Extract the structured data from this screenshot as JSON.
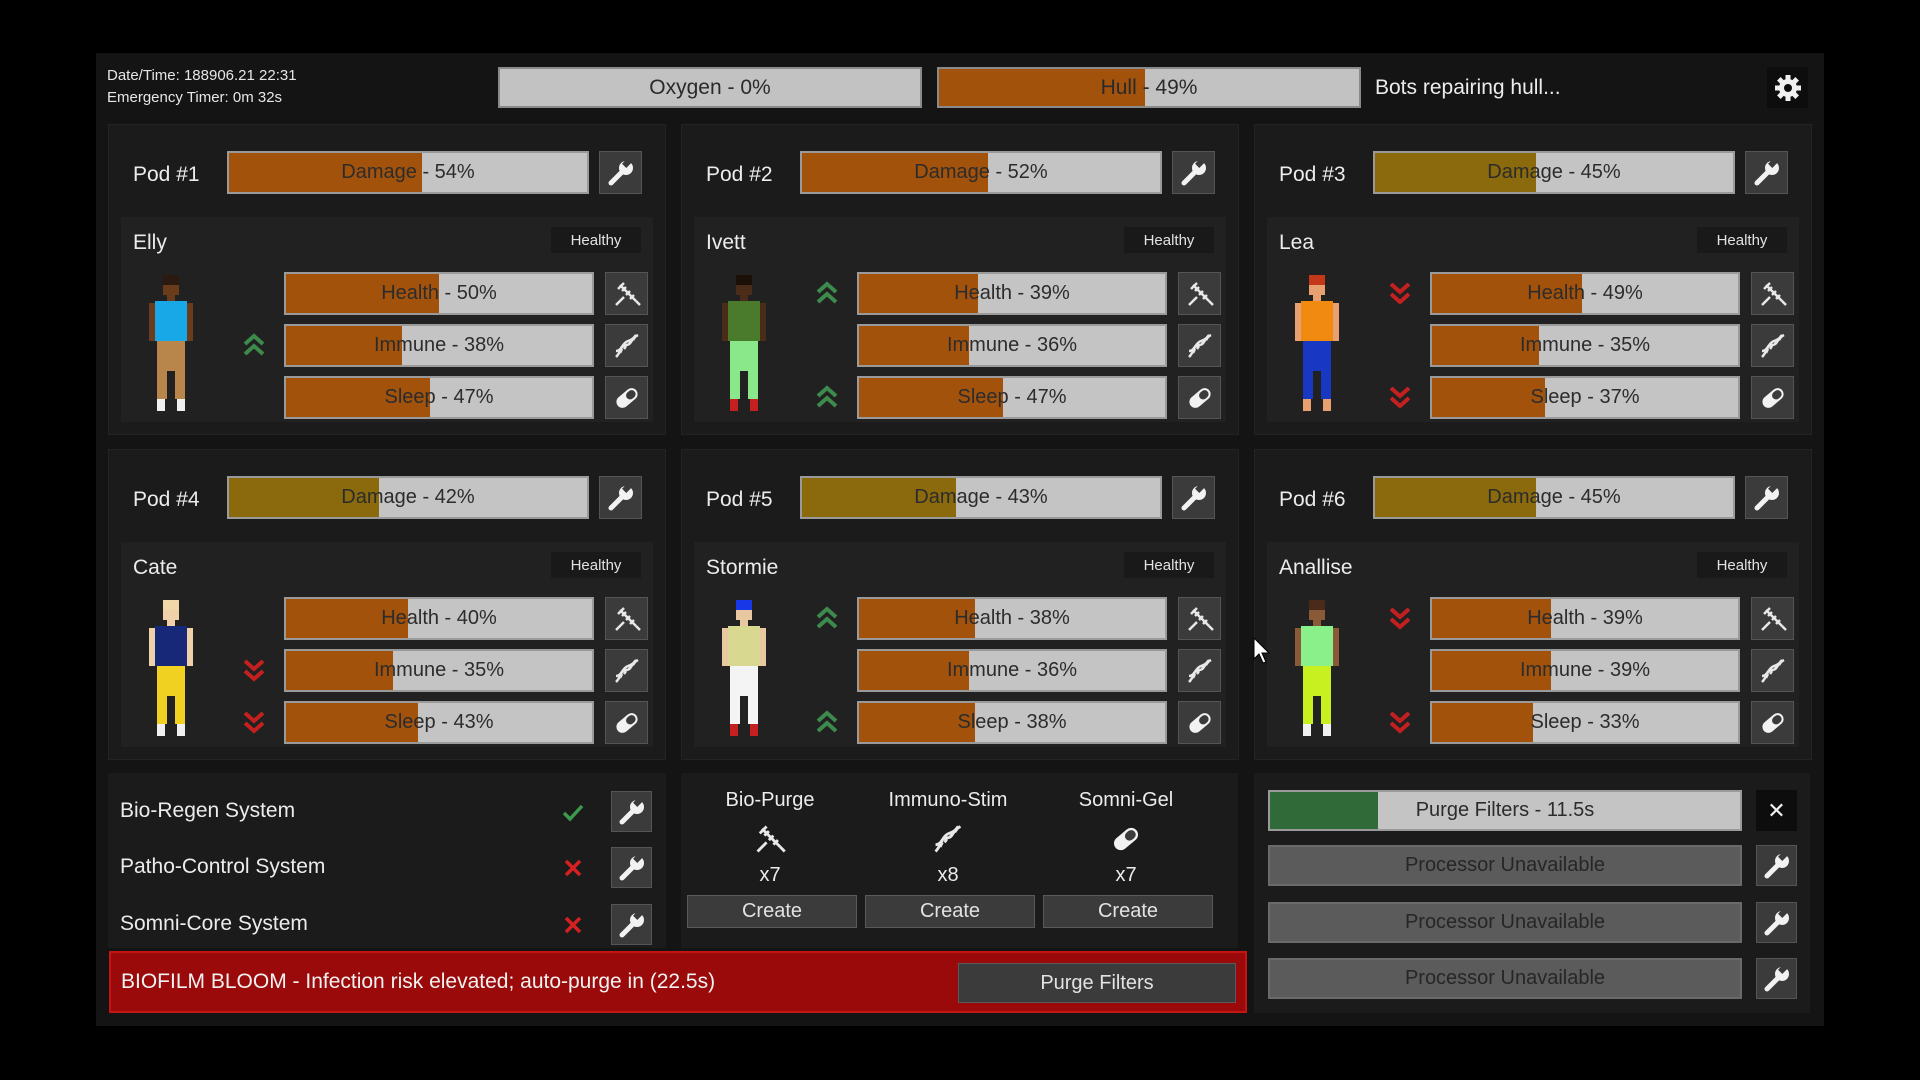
{
  "header": {
    "datetime": "Date/Time: 188906.21 22:31",
    "emergency_timer": "Emergency Timer: 0m 32s",
    "oxygen": {
      "label": "Oxygen - 0%",
      "level_pct": 0
    },
    "hull": {
      "label": "Hull - 49%",
      "level_pct": 49
    },
    "status_message": "Bots repairing hull...",
    "settings_icon": "gear-icon"
  },
  "colors": {
    "bar_fill_critical": "#a3520c",
    "bar_fill_warning": "#8a6a0c",
    "bar_track": "#c4c4c4",
    "arrow_up": "#3c8a4c",
    "arrow_down": "#c42020",
    "check": "#3c9a4c",
    "cross": "#d42020",
    "alert_bg": "#9a0a0a"
  },
  "pods": [
    {
      "label": "Pod #1",
      "damage": {
        "label": "Damage - 54%",
        "pct": 54,
        "severity": "critical"
      },
      "occupant": {
        "name": "Elly",
        "status": "Healthy",
        "sprite": {
          "skin": "#6a3c1c",
          "hair": "#2a1a10",
          "top": "#18a8e8",
          "pants": "#b8864a",
          "shoes": "#f0f0f0"
        },
        "stats": [
          {
            "label": "Health - 50%",
            "pct": 50,
            "trend": "none",
            "icon": "syringe-icon"
          },
          {
            "label": "Immune - 38%",
            "pct": 38,
            "trend": "up",
            "icon": "dna-icon"
          },
          {
            "label": "Sleep - 47%",
            "pct": 47,
            "trend": "none",
            "icon": "pill-icon"
          }
        ]
      }
    },
    {
      "label": "Pod #2",
      "damage": {
        "label": "Damage - 52%",
        "pct": 52,
        "severity": "critical"
      },
      "occupant": {
        "name": "Ivett",
        "status": "Healthy",
        "sprite": {
          "skin": "#4a2c18",
          "hair": "#1a1008",
          "top": "#4a7a2c",
          "pants": "#8ae88a",
          "shoes": "#c42020"
        },
        "stats": [
          {
            "label": "Health - 39%",
            "pct": 39,
            "trend": "up",
            "icon": "syringe-icon"
          },
          {
            "label": "Immune - 36%",
            "pct": 36,
            "trend": "none",
            "icon": "dna-icon"
          },
          {
            "label": "Sleep - 47%",
            "pct": 47,
            "trend": "up",
            "icon": "pill-icon"
          }
        ]
      }
    },
    {
      "label": "Pod #3",
      "damage": {
        "label": "Damage - 45%",
        "pct": 45,
        "severity": "warning"
      },
      "occupant": {
        "name": "Lea",
        "status": "Healthy",
        "sprite": {
          "skin": "#e8a070",
          "hair": "#c43818",
          "top": "#f08a10",
          "pants": "#1838c4",
          "shoes": "#e8a070"
        },
        "stats": [
          {
            "label": "Health - 49%",
            "pct": 49,
            "trend": "down",
            "icon": "syringe-icon"
          },
          {
            "label": "Immune - 35%",
            "pct": 35,
            "trend": "none",
            "icon": "dna-icon"
          },
          {
            "label": "Sleep - 37%",
            "pct": 37,
            "trend": "down",
            "icon": "pill-icon"
          }
        ]
      }
    },
    {
      "label": "Pod #4",
      "damage": {
        "label": "Damage - 42%",
        "pct": 42,
        "severity": "warning"
      },
      "occupant": {
        "name": "Cate",
        "status": "Healthy",
        "sprite": {
          "skin": "#f0d0a8",
          "hair": "#f0d8a8",
          "top": "#182878",
          "pants": "#f0d020",
          "shoes": "#f0f0f0"
        },
        "stats": [
          {
            "label": "Health - 40%",
            "pct": 40,
            "trend": "none",
            "icon": "syringe-icon"
          },
          {
            "label": "Immune - 35%",
            "pct": 35,
            "trend": "down",
            "icon": "dna-icon"
          },
          {
            "label": "Sleep - 43%",
            "pct": 43,
            "trend": "down",
            "icon": "pill-icon"
          }
        ]
      }
    },
    {
      "label": "Pod #5",
      "damage": {
        "label": "Damage - 43%",
        "pct": 43,
        "severity": "warning"
      },
      "occupant": {
        "name": "Stormie",
        "status": "Healthy",
        "sprite": {
          "skin": "#e8c8a0",
          "hair": "#1838e8",
          "top": "#d8d890",
          "pants": "#f4f4f4",
          "shoes": "#c42020"
        },
        "stats": [
          {
            "label": "Health - 38%",
            "pct": 38,
            "trend": "up",
            "icon": "syringe-icon"
          },
          {
            "label": "Immune - 36%",
            "pct": 36,
            "trend": "none",
            "icon": "dna-icon"
          },
          {
            "label": "Sleep - 38%",
            "pct": 38,
            "trend": "up",
            "icon": "pill-icon"
          }
        ]
      }
    },
    {
      "label": "Pod #6",
      "damage": {
        "label": "Damage - 45%",
        "pct": 45,
        "severity": "warning"
      },
      "occupant": {
        "name": "Anallise",
        "status": "Healthy",
        "sprite": {
          "skin": "#8a5a38",
          "hair": "#4a2a18",
          "top": "#8af08a",
          "pants": "#c8f020",
          "shoes": "#f0f0f0"
        },
        "stats": [
          {
            "label": "Health - 39%",
            "pct": 39,
            "trend": "down",
            "icon": "syringe-icon"
          },
          {
            "label": "Immune - 39%",
            "pct": 39,
            "trend": "none",
            "icon": "dna-icon"
          },
          {
            "label": "Sleep - 33%",
            "pct": 33,
            "trend": "down",
            "icon": "pill-icon"
          }
        ]
      }
    }
  ],
  "systems": [
    {
      "name": "Bio-Regen System",
      "ok": true
    },
    {
      "name": "Patho-Control System",
      "ok": false
    },
    {
      "name": "Somni-Core System",
      "ok": false
    }
  ],
  "treatments": [
    {
      "name": "Bio-Purge",
      "icon": "syringe-icon",
      "count": "x7",
      "button": "Create"
    },
    {
      "name": "Immuno-Stim",
      "icon": "dna-icon",
      "count": "x8",
      "button": "Create"
    },
    {
      "name": "Somni-Gel",
      "icon": "pill-icon",
      "count": "x7",
      "button": "Create"
    }
  ],
  "alert": {
    "text": "BIOFILM BLOOM - Infection risk elevated; auto-purge in (22.5s)",
    "button": "Purge Filters"
  },
  "processors": [
    {
      "label": "Purge Filters - 11.5s",
      "state": "active",
      "progress_pct": 23,
      "action": "close"
    },
    {
      "label": "Processor Unavailable",
      "state": "unavailable",
      "action": "repair"
    },
    {
      "label": "Processor Unavailable",
      "state": "unavailable",
      "action": "repair"
    },
    {
      "label": "Processor Unavailable",
      "state": "unavailable",
      "action": "repair"
    }
  ]
}
